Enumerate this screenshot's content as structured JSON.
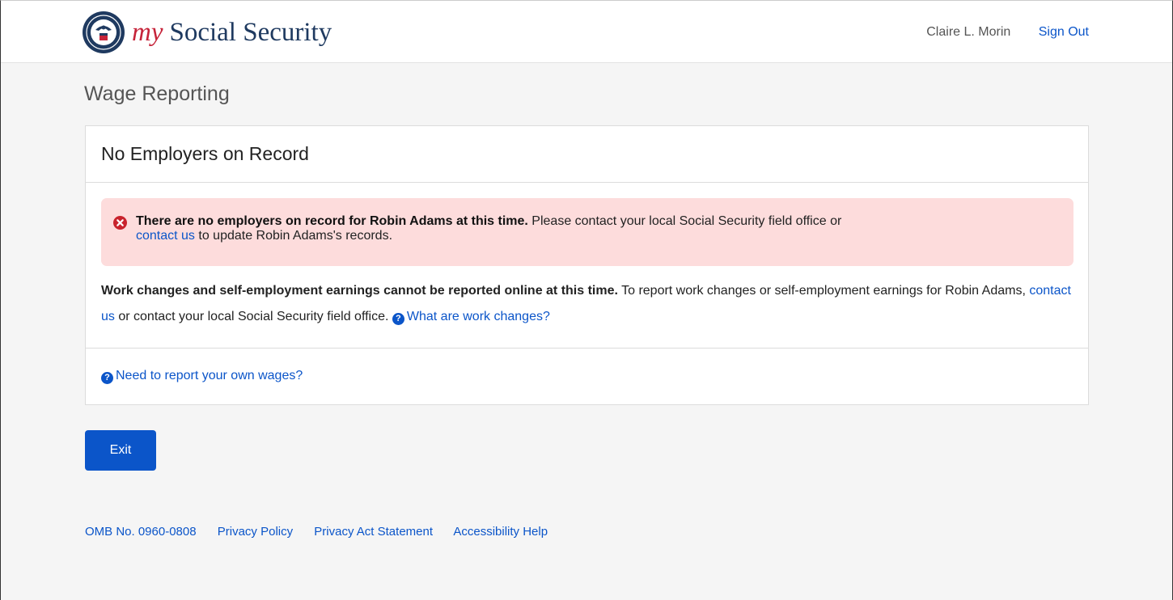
{
  "header": {
    "brand_my": "my",
    "brand_name": "Social Security",
    "user_name": "Claire L. Morin",
    "sign_out_label": "Sign Out"
  },
  "page": {
    "title": "Wage Reporting"
  },
  "card": {
    "title": "No Employers on Record",
    "alert": {
      "bold_text": "There are no employers on record for Robin Adams at this time.",
      "text_1": " Please contact your local Social Security field office or",
      "link_label": "contact us",
      "text_2": " to update Robin Adams's records."
    },
    "info": {
      "bold_text": "Work changes and self-employment earnings cannot be reported online at this time.",
      "text_1": " To report work changes or self-employment earnings for Robin Adams, ",
      "link_label": "contact us",
      "text_2": " or contact your local Social Security field office. ",
      "help_link_label": "What are work changes?"
    },
    "own_wages_link_label": "Need to report your own wages?"
  },
  "actions": {
    "exit_label": "Exit"
  },
  "footer": {
    "links": [
      "OMB No. 0960-0808",
      "Privacy Policy",
      "Privacy Act Statement",
      "Accessibility Help"
    ]
  },
  "colors": {
    "accent": "#0b55c9",
    "alert_bg": "#fddcdc",
    "error_icon": "#c9232d",
    "brand_red": "#c6243a",
    "brand_navy": "#1f3a60"
  },
  "icons": {
    "logo": "ssa-seal-icon",
    "alert": "error-circle-x-icon",
    "help": "question-circle-icon"
  }
}
